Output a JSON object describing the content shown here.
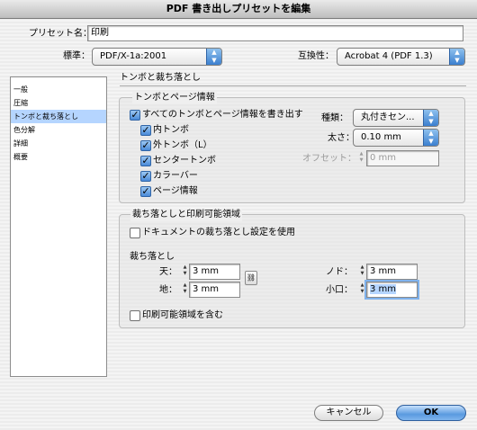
{
  "window": {
    "title": "PDF 書き出しプリセットを編集"
  },
  "preset_name": {
    "label": "プリセット名：",
    "value": "印刷"
  },
  "standard": {
    "label": "標準：",
    "value": "PDF/X-1a:2001"
  },
  "compat": {
    "label": "互換性：",
    "value": "Acrobat 4 (PDF 1.3)"
  },
  "sidebar": {
    "items": [
      {
        "label": "一般"
      },
      {
        "label": "圧縮"
      },
      {
        "label": "トンボと裁ち落とし"
      },
      {
        "label": "色分解"
      },
      {
        "label": "詳細"
      },
      {
        "label": "概要"
      }
    ]
  },
  "section_title": "トンボと裁ち落とし",
  "marks": {
    "group_title": "トンボとページ情報",
    "all_marks": "すべてのトンボとページ情報を書き出す",
    "crop": "内トンボ",
    "bleed": "外トンボ（L）",
    "registration": "センタートンボ",
    "color_bars": "カラーバー",
    "page_info": "ページ情報",
    "type_label": "種類：",
    "type_value": "丸付きセン...",
    "weight_label": "太さ：",
    "weight_value": "0.10 mm",
    "offset_label": "オフセット：",
    "offset_value": "0 mm"
  },
  "bleed": {
    "group_title": "裁ち落としと印刷可能領域",
    "use_doc": "ドキュメントの裁ち落とし設定を使用",
    "bleed_heading": "裁ち落とし",
    "top_label": "天：",
    "top_value": "3 mm",
    "bottom_label": "地：",
    "bottom_value": "3 mm",
    "inside_label": "ノド：",
    "inside_value": "3 mm",
    "outside_label": "小口：",
    "outside_value": "3 mm",
    "include_slug": "印刷可能領域を含む"
  },
  "buttons": {
    "cancel": "キャンセル",
    "ok": "OK"
  },
  "colors": {
    "selection": "#b5d5ff",
    "accent": "#4a8ad8"
  }
}
